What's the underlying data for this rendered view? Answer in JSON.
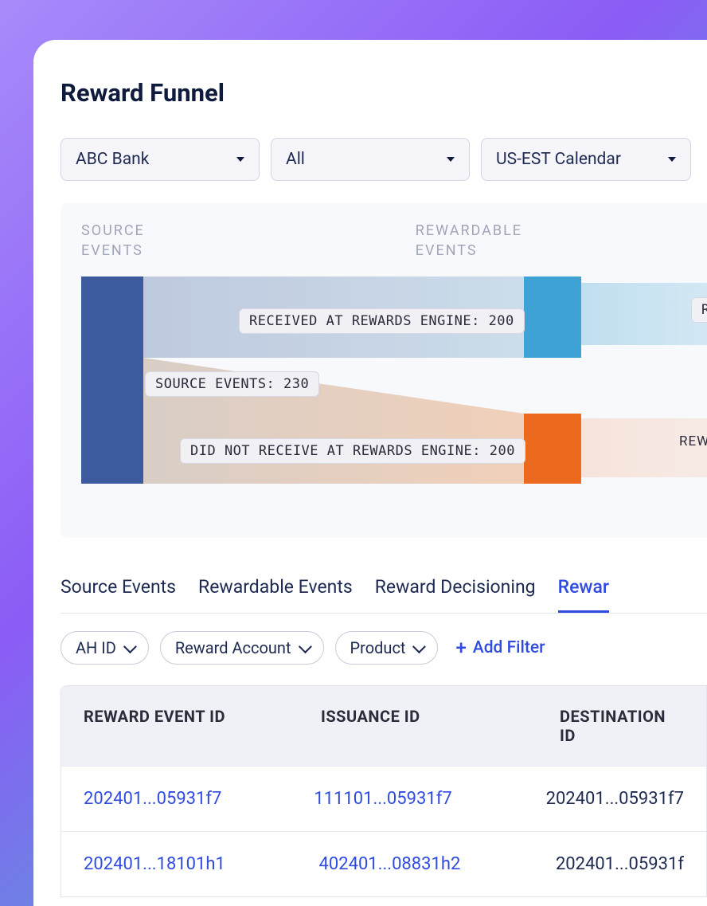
{
  "page": {
    "title": "Reward Funnel"
  },
  "dropdowns": {
    "bank": "ABC Bank",
    "scope": "All",
    "calendar": "US-EST Calendar"
  },
  "funnel": {
    "header1": "SOURCE\nEVENTS",
    "header2": "REWARDABLE\nEVENTS",
    "received_label": "RECEIVED AT REWARDS ENGINE: 200",
    "source_label": "SOURCE EVENTS: 230",
    "notreceived_label": "DID NOT RECEIVE AT REWARDS ENGINE: 200",
    "right_pill": "R",
    "rew_text": "REW"
  },
  "tabs": {
    "t1": "Source Events",
    "t2": "Rewardable Events",
    "t3": "Reward Decisioning",
    "t4": "Rewar"
  },
  "chips": {
    "ahid": "AH ID",
    "account": "Reward Account",
    "product": "Product"
  },
  "add_filter": "Add Filter",
  "table": {
    "headers": {
      "c1": "REWARD EVENT ID",
      "c2": "ISSUANCE ID",
      "c3": "DESTINATION ID"
    },
    "rows": [
      {
        "c1": "202401...05931f7",
        "c2": "111101...05931f7",
        "c3": "202401...05931f7"
      },
      {
        "c1": "202401...18101h1",
        "c2": "402401...08831h2",
        "c3": "202401...05931f"
      }
    ]
  },
  "chart_data": {
    "type": "sankey",
    "nodes": [
      {
        "name": "Source Events",
        "value": 230
      },
      {
        "name": "Received at Rewards Engine",
        "value": 200
      },
      {
        "name": "Did Not Receive at Rewards Engine",
        "value": 200
      }
    ],
    "links": [
      {
        "source": "Source Events",
        "target": "Received at Rewards Engine",
        "value": 200
      },
      {
        "source": "Source Events",
        "target": "Did Not Receive at Rewards Engine",
        "value": 200
      }
    ]
  }
}
